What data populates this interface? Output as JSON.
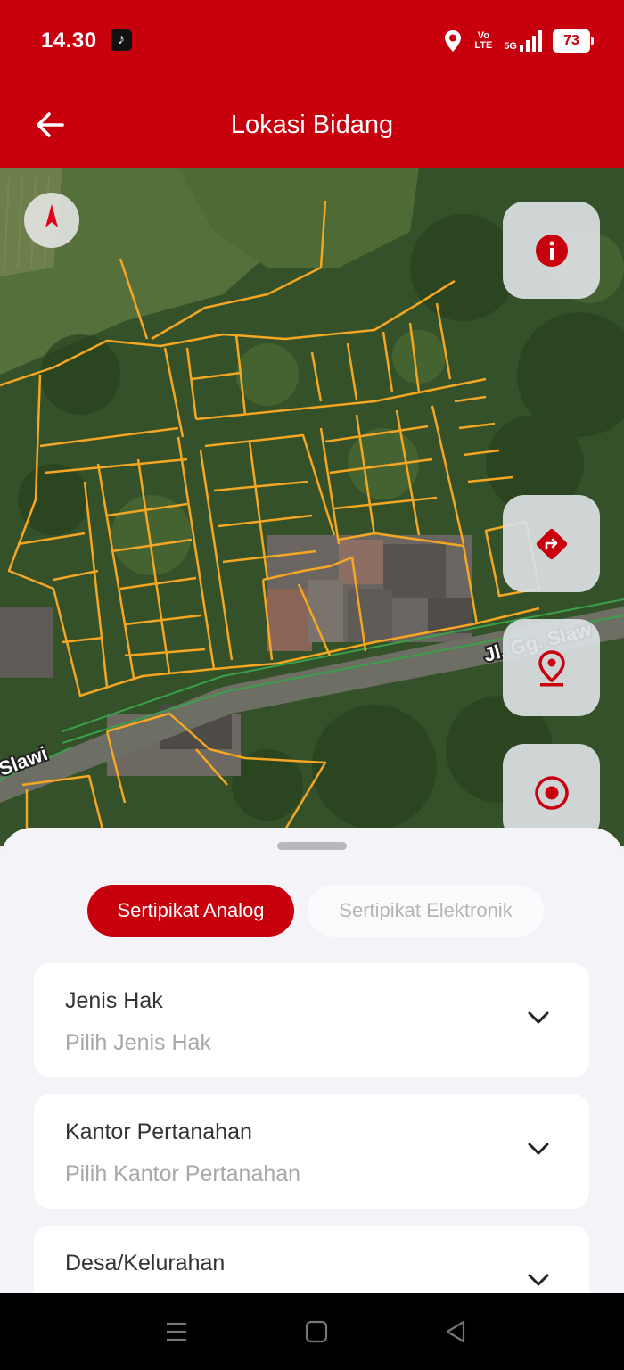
{
  "status_bar": {
    "time": "14.30",
    "tiktok_icon": "tiktok-icon",
    "volte": "Vo LTE",
    "network": "5G",
    "battery": "73"
  },
  "app_bar": {
    "title": "Lokasi Bidang",
    "back_icon": "arrow-left-icon"
  },
  "map": {
    "street_right": "Jl. Gg. Slaw",
    "street_left": "Slawi",
    "buttons": [
      "info-icon",
      "directions-icon",
      "location-pin-icon",
      "target-icon"
    ]
  },
  "sheet": {
    "tabs": {
      "active": "Sertipikat Analog",
      "inactive": "Sertipikat Elektronik"
    },
    "fields": [
      {
        "label": "Jenis Hak",
        "placeholder": "Pilih Jenis Hak"
      },
      {
        "label": "Kantor Pertanahan",
        "placeholder": "Pilih Kantor Pertanahan"
      },
      {
        "label": "Desa/Kelurahan",
        "placeholder": ""
      }
    ]
  },
  "colors": {
    "brand_red": "#c8000e",
    "parcel_outline": "#f5a623",
    "road_line": "#3aa14a"
  }
}
